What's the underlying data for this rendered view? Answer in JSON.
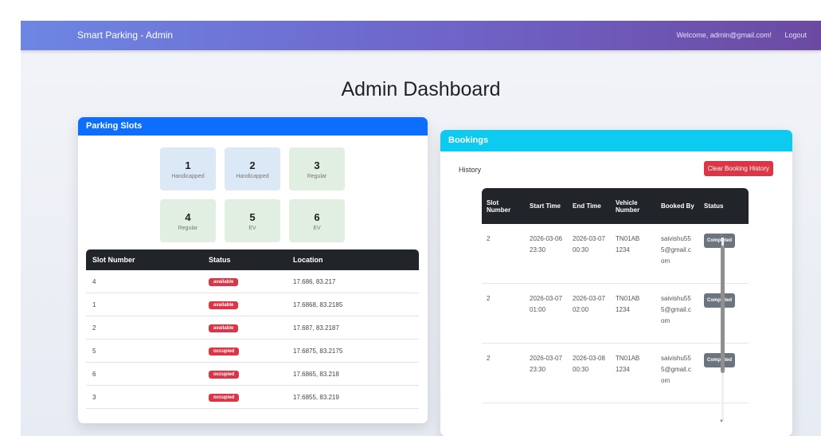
{
  "navbar": {
    "brand": "Smart Parking - Admin",
    "welcome": "Welcome, admin@gmail.com!",
    "logout": "Logout"
  },
  "page_title": "Admin Dashboard",
  "parking_slots": {
    "header": "Parking Slots",
    "grid": [
      {
        "number": "1",
        "type": "Handicapped"
      },
      {
        "number": "2",
        "type": "Handicapped"
      },
      {
        "number": "3",
        "type": "Regular"
      },
      {
        "number": "4",
        "type": "Regular"
      },
      {
        "number": "5",
        "type": "EV"
      },
      {
        "number": "6",
        "type": "EV"
      }
    ],
    "columns": [
      "Slot Number",
      "Status",
      "Location"
    ],
    "rows": [
      {
        "slot": "4",
        "status": "available",
        "location": "17.686, 83.217"
      },
      {
        "slot": "1",
        "status": "available",
        "location": "17.6868, 83.2185"
      },
      {
        "slot": "2",
        "status": "available",
        "location": "17.687, 83.2187"
      },
      {
        "slot": "5",
        "status": "occupied",
        "location": "17.6875, 83.2175"
      },
      {
        "slot": "6",
        "status": "occupied",
        "location": "17.6865, 83.218"
      },
      {
        "slot": "3",
        "status": "occupied",
        "location": "17.6855, 83.219"
      }
    ]
  },
  "bookings": {
    "header": "Bookings",
    "history_label": "History",
    "clear_button": "Clear Booking History",
    "columns": [
      "Slot Number",
      "Start Time",
      "End Time",
      "Vehicle Number",
      "Booked By",
      "Status"
    ],
    "rows": [
      {
        "slot": "2",
        "start": "2026-03-06 23:30",
        "end": "2026-03-07 00:30",
        "vehicle": "TN01AB 1234",
        "booked_by": "saivishu555@gmail.com",
        "status": "Completed"
      },
      {
        "slot": "2",
        "start": "2026-03-07 01:00",
        "end": "2026-03-07 02:00",
        "vehicle": "TN01AB 1234",
        "booked_by": "saivishu555@gmail.com",
        "status": "Completed"
      },
      {
        "slot": "2",
        "start": "2026-03-07 23:30",
        "end": "2026-03-08 00:30",
        "vehicle": "TN01AB 1234",
        "booked_by": "saivishu555@gmail.com",
        "status": "Completed"
      }
    ]
  },
  "colors": {
    "primary": "#0d6efd",
    "info": "#0dcaf0",
    "danger": "#dc3545",
    "dark": "#212529",
    "secondary": "#6c757d"
  }
}
